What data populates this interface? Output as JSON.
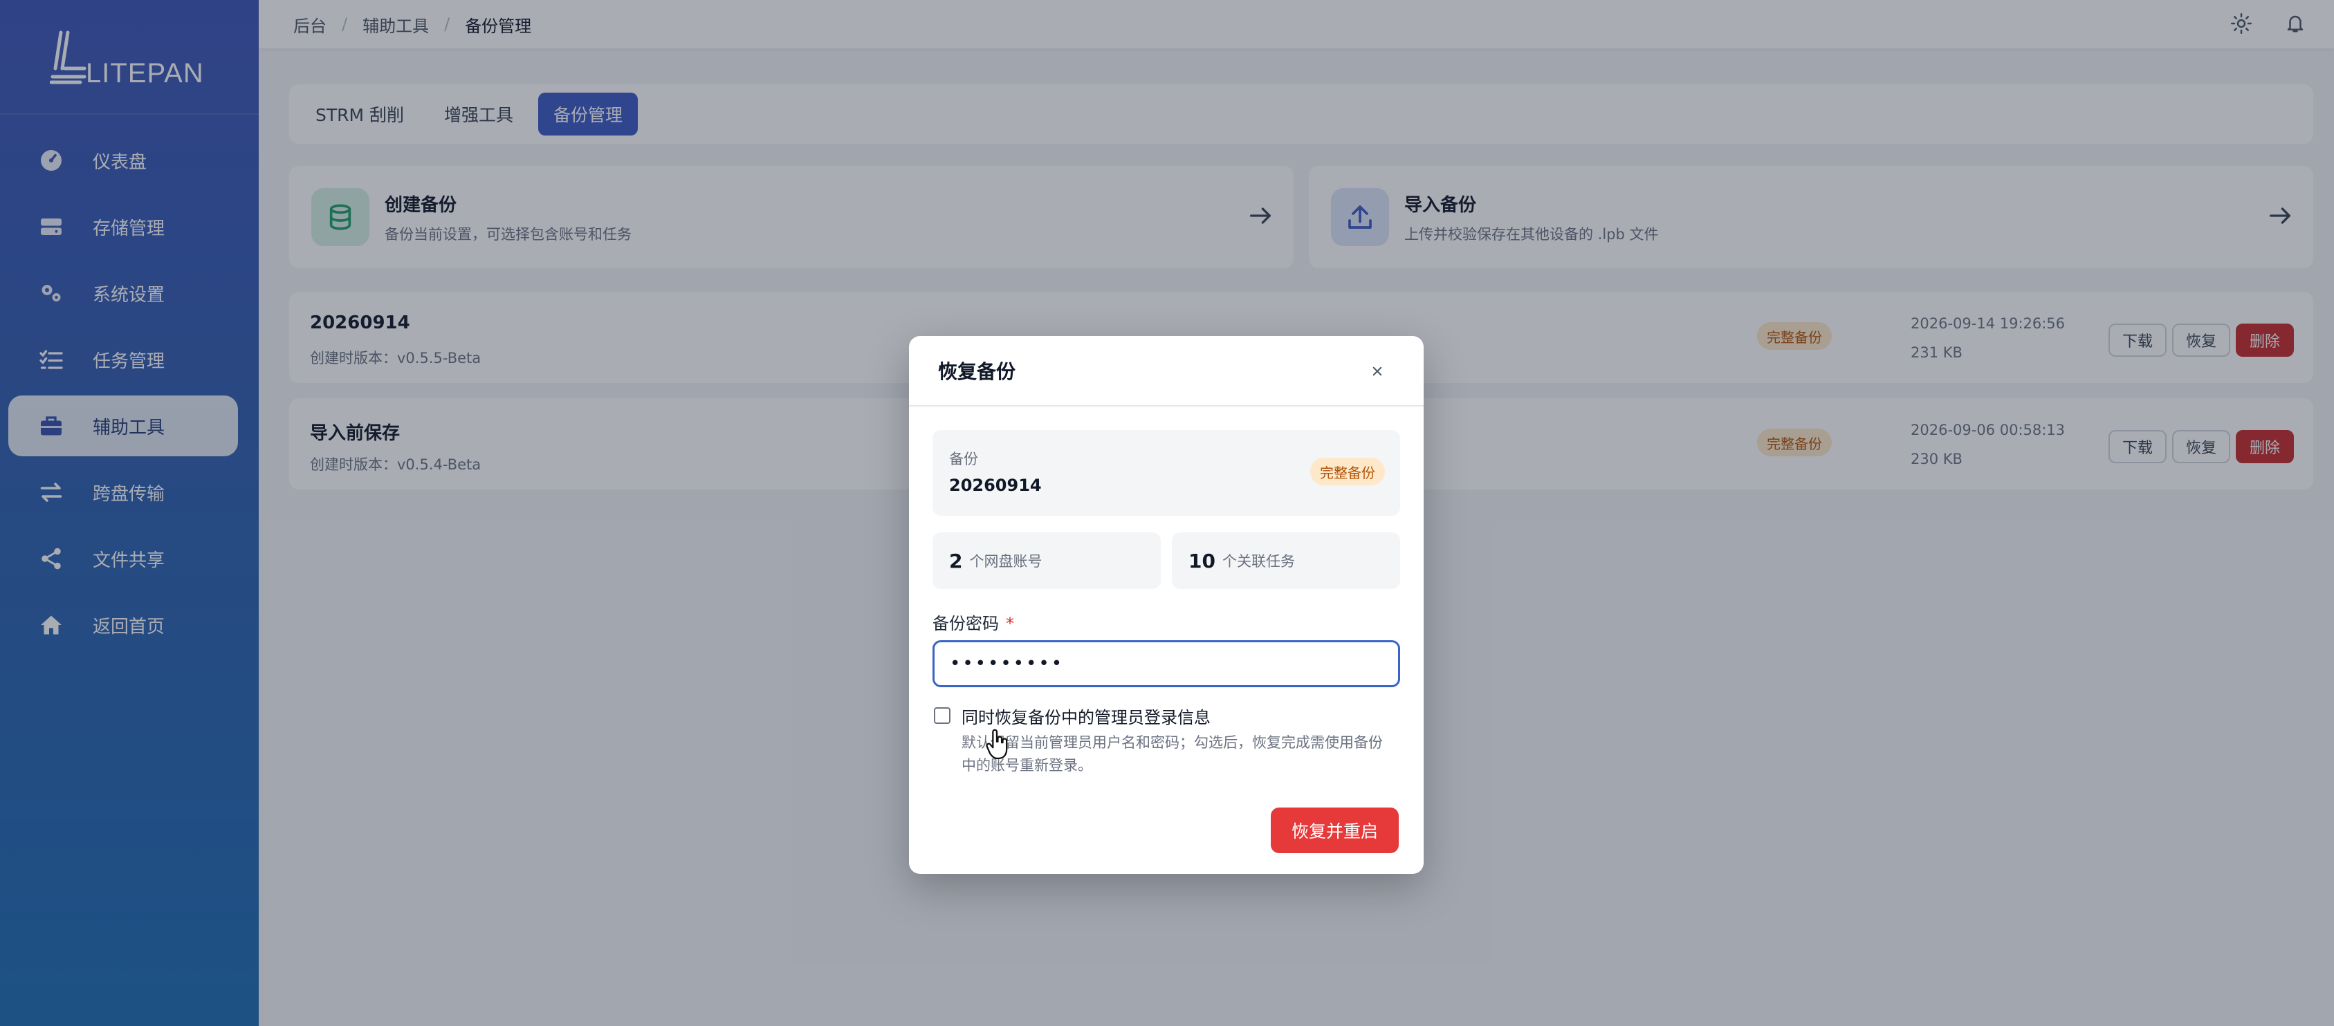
{
  "app": {
    "logo_text": "LITEPAN"
  },
  "sidebar": {
    "items": [
      {
        "label": "仪表盘",
        "icon": "dashboard-icon"
      },
      {
        "label": "存储管理",
        "icon": "storage-icon"
      },
      {
        "label": "系统设置",
        "icon": "settings-icon"
      },
      {
        "label": "任务管理",
        "icon": "tasks-icon"
      },
      {
        "label": "辅助工具",
        "icon": "toolbox-icon",
        "active": true
      },
      {
        "label": "跨盘传输",
        "icon": "transfer-icon"
      },
      {
        "label": "文件共享",
        "icon": "share-icon"
      },
      {
        "label": "返回首页",
        "icon": "home-icon"
      }
    ]
  },
  "breadcrumb": {
    "items": [
      "后台",
      "辅助工具",
      "备份管理"
    ]
  },
  "header_icons": [
    "theme-sun-icon",
    "bell-icon"
  ],
  "tabs": [
    {
      "label": "STRM 刮削"
    },
    {
      "label": "增强工具"
    },
    {
      "label": "备份管理",
      "active": true
    }
  ],
  "actions": {
    "create": {
      "title": "创建备份",
      "desc": "备份当前设置，可选择包含账号和任务"
    },
    "import": {
      "title": "导入备份",
      "desc": "上传并校验保存在其他设备的 .lpb 文件"
    }
  },
  "backups": [
    {
      "name": "20260914",
      "version": "创建时版本：v0.5.5-Beta",
      "badge": "完整备份",
      "time": "2026-09-14 19:26:56",
      "size": "231 KB"
    },
    {
      "name": "导入前保存",
      "version": "创建时版本：v0.5.4-Beta",
      "badge": "完整备份",
      "time": "2026-09-06 00:58:13",
      "size": "230 KB"
    }
  ],
  "row_buttons": {
    "download": "下载",
    "restore": "恢复",
    "delete": "删除"
  },
  "modal": {
    "title": "恢复备份",
    "backup_label": "备份",
    "backup_name": "20260914",
    "badge": "完整备份",
    "accounts_count": "2",
    "accounts_label": "个网盘账号",
    "tasks_count": "10",
    "tasks_label": "个关联任务",
    "password_label": "备份密码",
    "required_mark": "*",
    "password_value": "•••••••••",
    "checkbox_label": "同时恢复备份中的管理员登录信息",
    "checkbox_desc": "默认保留当前管理员用户名和密码；勾选后，恢复完成需使用备份中的账号重新登录。",
    "submit_label": "恢复并重启"
  },
  "colors": {
    "accent": "#3b59c4",
    "danger": "#e5393a",
    "badge_bg": "#fde9c9",
    "badge_text": "#b45309"
  }
}
